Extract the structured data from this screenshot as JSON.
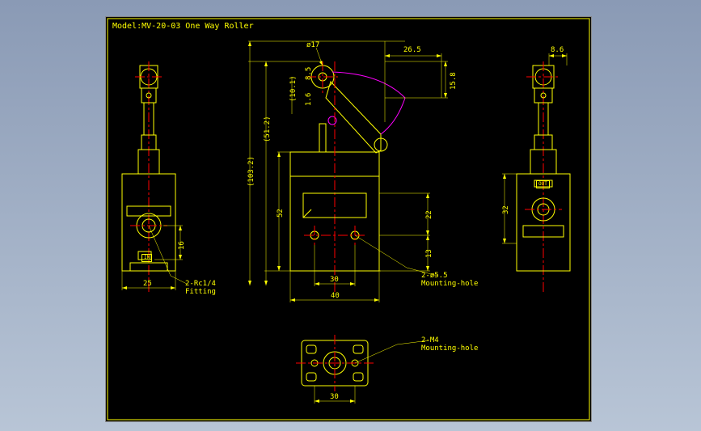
{
  "title": "Model:MV-20-03 One Way Roller",
  "dimensions": {
    "dia17": "ø17",
    "d26_5": "26.5",
    "d8_6": "8.6",
    "d15_8": "15.8",
    "d8_5": "8.5",
    "d1_6": "1.6",
    "d10_1": "(10.1)",
    "d51_2": "(51.2)",
    "d103_2": "(103.2)",
    "d52": "52",
    "d22": "22",
    "d13": "13",
    "d32": "32",
    "d30": "30",
    "d30_b": "30",
    "d40": "40",
    "d25": "25",
    "d16": "16"
  },
  "labels": {
    "fitting": "2-Rc1/4\nFitting",
    "mounting_hole_1": "2-ø5.5\nMounting-hole",
    "mounting_hole_2": "2-M4\nMounting-hole",
    "out": "OUT",
    "in": "IN"
  }
}
